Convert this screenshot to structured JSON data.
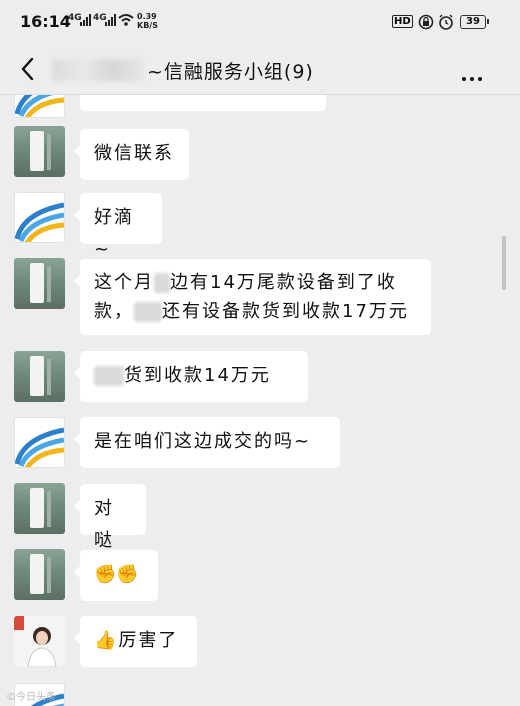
{
  "status_bar": {
    "time": "16:14",
    "signal_1": "4G",
    "signal_2": "4G",
    "speed_value": "0.39",
    "speed_unit": "KB/S",
    "hd_label": "HD",
    "battery": "39"
  },
  "header": {
    "title": "~信融服务小组(9)"
  },
  "messages": [
    {
      "text": ""
    },
    {
      "text": "微信联系"
    },
    {
      "text": "好滴~"
    },
    {
      "line1_a": "这个月",
      "line1_b": "边有14万尾款设备到了收",
      "line2_a": "款，",
      "line2_b": "还有设备款货到收款17万元"
    },
    {
      "text": "货到收款14万元"
    },
    {
      "text": "是在咱们这边成交的吗~"
    },
    {
      "text": "对哒"
    },
    {
      "text": "✊✊"
    },
    {
      "text": "👍厉害了"
    }
  ],
  "watermark": "©今日头条"
}
